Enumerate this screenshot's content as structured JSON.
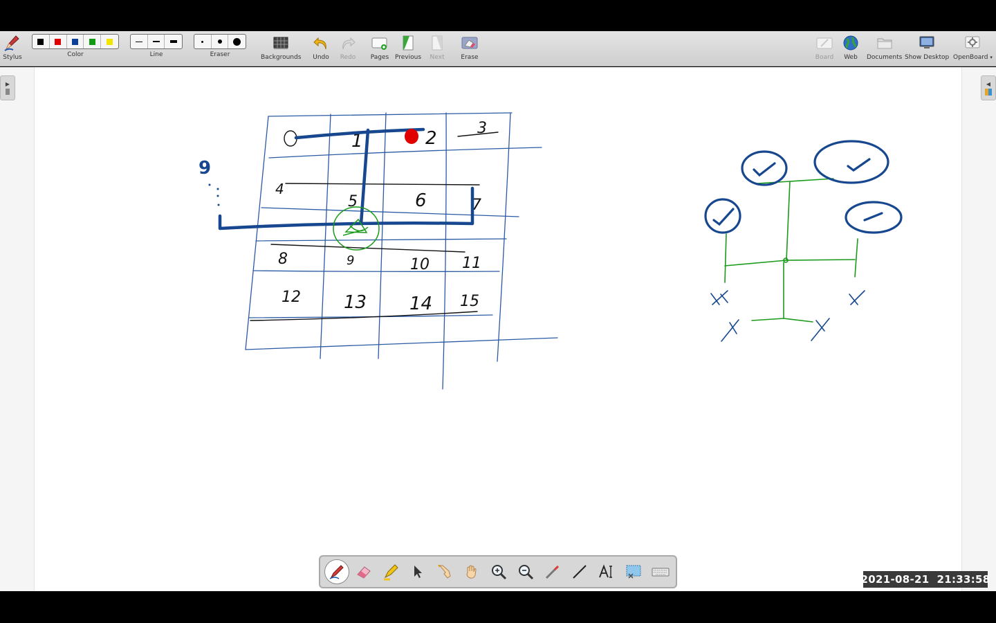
{
  "toolbar": {
    "stylus_label": "Stylus",
    "color_label": "Color",
    "line_label": "Line",
    "eraser_label": "Eraser",
    "backgrounds_label": "Backgrounds",
    "undo_label": "Undo",
    "redo_label": "Redo",
    "pages_label": "Pages",
    "previous_label": "Previous",
    "next_label": "Next",
    "erase_label": "Erase",
    "board_label": "Board",
    "web_label": "Web",
    "documents_label": "Documents",
    "show_desktop_label": "Show Desktop",
    "openboard_label": "OpenBoard",
    "colors": [
      "#000000",
      "#e00000",
      "#0b3f9a",
      "#129a12",
      "#f2e600"
    ]
  },
  "board": {
    "grid_numbers": [
      "0",
      "1",
      "2",
      "3",
      "4",
      "5",
      "6",
      "7",
      "8",
      "9",
      "10",
      "11",
      "12",
      "13",
      "14",
      "15"
    ],
    "side_number": "9",
    "ink_blue": "#17478f",
    "ink_green": "#1a9a1a",
    "ink_red": "#e00000"
  },
  "palette": {
    "tools": [
      "pen",
      "eraser",
      "highlighter",
      "selector",
      "interactor",
      "hand",
      "zoom-in",
      "zoom-out",
      "laser",
      "line",
      "text",
      "capture",
      "keyboard"
    ]
  },
  "timestamp": "2021-08-21  21:33:58"
}
